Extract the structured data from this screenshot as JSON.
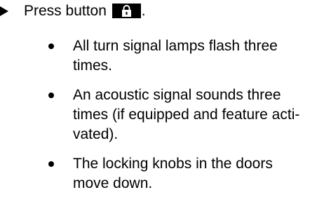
{
  "step": {
    "text_before": "Press button",
    "text_after": ".",
    "button_icon": "padlock-closed-icon"
  },
  "results": [
    {
      "lines": [
        "All turn signal lamps flash three",
        "times."
      ]
    },
    {
      "lines": [
        "An acoustic signal sounds three",
        "times (if equipped and feature acti-",
        "vated)."
      ]
    },
    {
      "lines": [
        "The locking knobs in the doors",
        "move down."
      ]
    }
  ]
}
